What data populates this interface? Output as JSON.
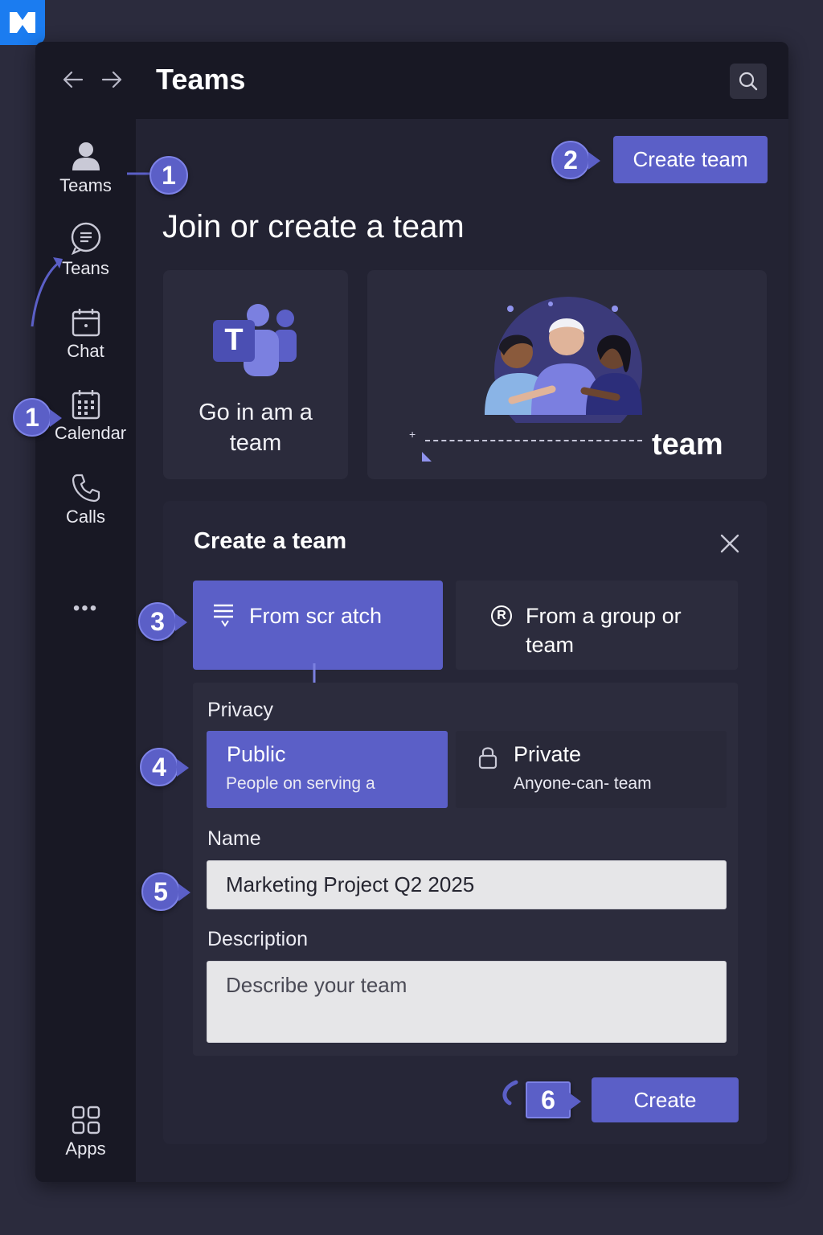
{
  "window": {
    "title": "Teams"
  },
  "rail": {
    "items": [
      {
        "label": "Teams",
        "icon": "person-icon"
      },
      {
        "label": "Teans",
        "icon": "chat-bubble-icon"
      },
      {
        "label": "Chat",
        "icon": "calendar-small-icon"
      },
      {
        "label": "Calendar",
        "icon": "calendar-grid-icon"
      },
      {
        "label": "Calls",
        "icon": "phone-icon"
      },
      {
        "label": "Apps",
        "icon": "apps-grid-icon"
      }
    ],
    "more": "•••"
  },
  "header": {
    "create_team_label": "Create team"
  },
  "page": {
    "heading": "Join or create a team"
  },
  "join_card": {
    "logo_letter": "T",
    "text_line1": "Go in am a",
    "text_line2": "team"
  },
  "hero_card": {
    "caption": "team"
  },
  "panel": {
    "title": "Create a team",
    "options": [
      {
        "label": "From scr atch",
        "icon": "list-icon"
      },
      {
        "label_line1": "From a group or",
        "label_line2": "team",
        "icon": "registered-circle-icon",
        "icon_glyph": "R"
      }
    ],
    "privacy": {
      "label": "Privacy",
      "public": {
        "title": "Public",
        "sub": "People on serving a"
      },
      "private": {
        "title": "Private",
        "sub": "Anyone-can- team",
        "icon": "lock-icon"
      }
    },
    "name": {
      "label": "Name",
      "value": "Marketing Project Q2 2025"
    },
    "description": {
      "label": "Description",
      "placeholder": "Describe your team"
    },
    "create_label": "Create"
  },
  "callouts": [
    "1",
    "2",
    "1",
    "3",
    "4",
    "5",
    "6"
  ],
  "colors": {
    "accent": "#5b5fc7",
    "window_bg": "#1d1d2a",
    "rail_bg": "#181824",
    "main_bg": "#232333",
    "logo": "#1b7cf0"
  }
}
